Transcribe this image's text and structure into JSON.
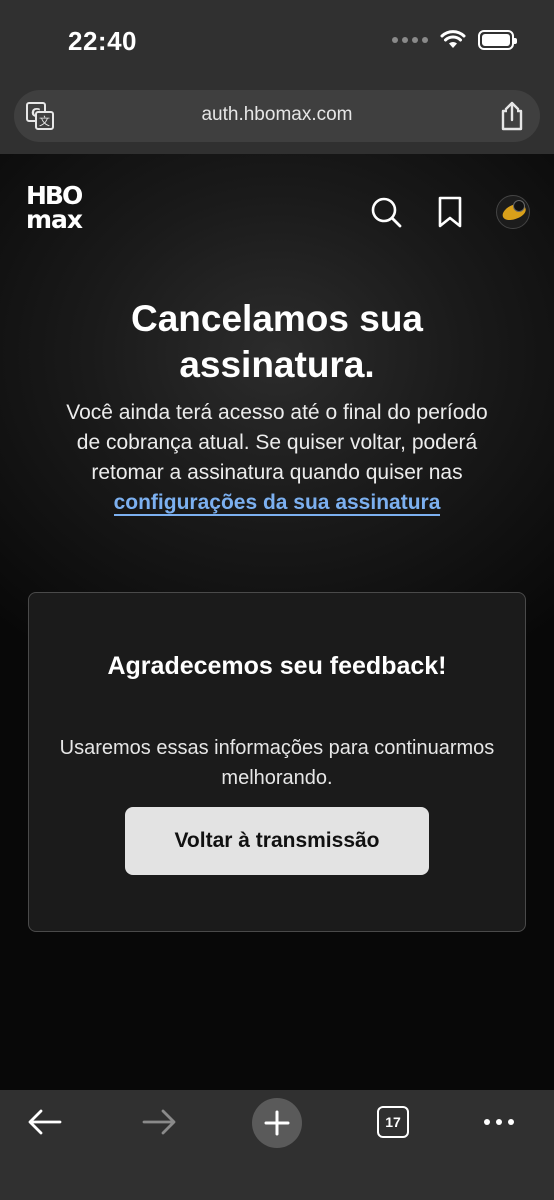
{
  "status_bar": {
    "time": "22:40"
  },
  "browser": {
    "url": "auth.hbomax.com",
    "tab_count": "17",
    "icons": [
      "translate-icon",
      "share-icon",
      "back-arrow-icon",
      "forward-arrow-icon",
      "plus-icon",
      "tabs-icon",
      "more-icon"
    ]
  },
  "header": {
    "logo_hbo": "HBO",
    "logo_max": "max",
    "icons": [
      "search-icon",
      "bookmark-icon",
      "avatar"
    ]
  },
  "hero": {
    "title": "Cancelamos sua assinatura.",
    "body": "Você ainda terá acesso até o final do período de cobrança atual. Se quiser voltar, poderá retomar a assinatura quando quiser nas ",
    "link": "configurações da sua assinatura"
  },
  "feedback": {
    "title": "Agradecemos seu feedback!",
    "body": "Usaremos essas informações para continuarmos melhorando.",
    "button_label": "Voltar à transmissão"
  },
  "colors": {
    "link": "#7cb0f0",
    "chrome": "#303030",
    "button_bg": "#e3e3e3"
  }
}
